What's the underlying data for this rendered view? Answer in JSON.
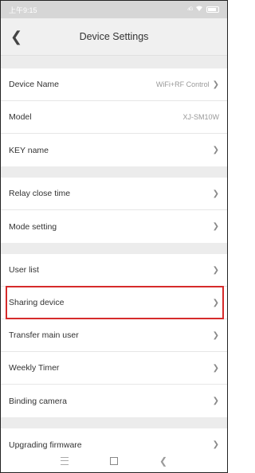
{
  "status": {
    "time": "上午9:15",
    "signal": "⁴ᴳ",
    "wifi": "wifi-icon",
    "battery": "battery-icon"
  },
  "header": {
    "title": "Device Settings"
  },
  "groups": [
    [
      {
        "label": "Device Name",
        "value": "WiFi+RF Control"
      },
      {
        "label": "Model",
        "value": "XJ-SM10W"
      },
      {
        "label": "KEY name",
        "value": ""
      }
    ],
    [
      {
        "label": "Relay close time",
        "value": ""
      },
      {
        "label": "Mode setting",
        "value": ""
      }
    ],
    [
      {
        "label": "User list",
        "value": ""
      },
      {
        "label": "Sharing device",
        "value": ""
      },
      {
        "label": "Transfer main user",
        "value": ""
      },
      {
        "label": "Weekly Timer",
        "value": ""
      },
      {
        "label": "Binding camera",
        "value": ""
      }
    ],
    [
      {
        "label": "Upgrading firmware",
        "value": ""
      }
    ]
  ],
  "colors": {
    "highlight": "#d62b2b",
    "status_bar": "#d6d6d6",
    "nav_bar": "#f0f0f0"
  }
}
